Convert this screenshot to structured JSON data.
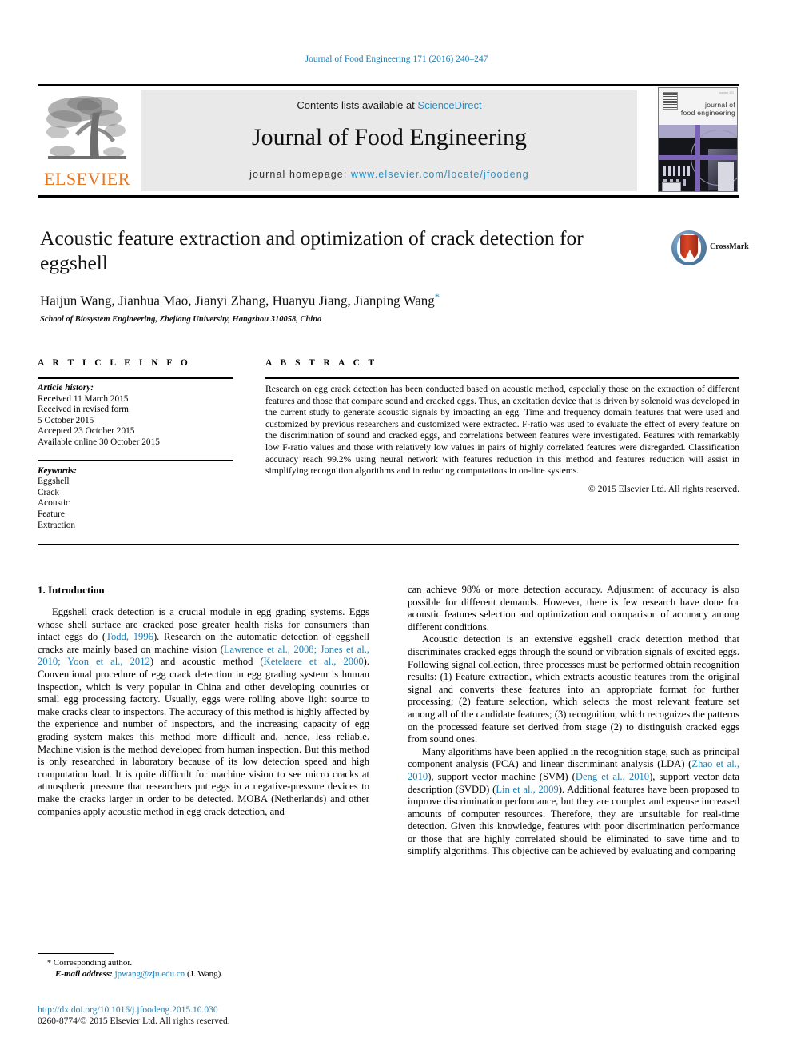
{
  "running_head": "Journal of Food Engineering 171 (2016) 240–247",
  "masthead": {
    "contents_prefix": "Contents lists available at ",
    "contents_link": "ScienceDirect",
    "journal_name": "Journal of Food Engineering",
    "homepage_prefix": "journal homepage: ",
    "homepage_url": "www.elsevier.com/locate/jfoodeng",
    "publisher": "ELSEVIER",
    "cover_title_line1": "journal of",
    "cover_title_line2": "food engineering",
    "cover_tiny": "volume 171"
  },
  "article": {
    "title": "Acoustic feature extraction and optimization of crack detection for eggshell",
    "authors": "Haijun Wang, Jianhua Mao, Jianyi Zhang, Huanyu Jiang, Jianping Wang",
    "corresponding_marker": "*",
    "affiliation": "School of Biosystem Engineering, Zhejiang University, Hangzhou 310058, China",
    "crossmark_label": "CrossMark"
  },
  "info": {
    "heading": "A R T I C L E   I N F O",
    "history_title": "Article history:",
    "history": [
      "Received 11 March 2015",
      "Received in revised form",
      "5 October 2015",
      "Accepted 23 October 2015",
      "Available online 30 October 2015"
    ],
    "keywords_title": "Keywords:",
    "keywords": [
      "Eggshell",
      "Crack",
      "Acoustic",
      "Feature",
      "Extraction"
    ]
  },
  "abstract": {
    "heading": "A B S T R A C T",
    "text": "Research on egg crack detection has been conducted based on acoustic method, especially those on the extraction of different features and those that compare sound and cracked eggs. Thus, an excitation device that is driven by solenoid was developed in the current study to generate acoustic signals by impacting an egg. Time and frequency domain features that were used and customized by previous researchers and customized were extracted. F-ratio was used to evaluate the effect of every feature on the discrimination of sound and cracked eggs, and correlations between features were investigated. Features with remarkably low F-ratio values and those with relatively low values in pairs of highly correlated features were disregarded. Classification accuracy reach 99.2% using neural network with features reduction in this method and features reduction will assist in simplifying recognition algorithms and in reducing computations in on-line systems.",
    "copyright": "© 2015 Elsevier Ltd. All rights reserved."
  },
  "body": {
    "section_heading": "1.  Introduction",
    "left_para1_a": "Eggshell crack detection is a crucial module in egg grading systems. Eggs whose shell surface are cracked pose greater health risks for consumers than intact eggs do (",
    "left_cit1": "Todd, 1996",
    "left_para1_b": "). Research on the automatic detection of eggshell cracks are mainly based on machine vision (",
    "left_cit2": "Lawrence et al., 2008; Jones et al., 2010; Yoon et al., 2012",
    "left_para1_c": ") and acoustic method (",
    "left_cit3": "Ketelaere et al., 2000",
    "left_para1_d": "). Conventional procedure of egg crack detection in egg grading system is human inspection, which is very popular in China and other developing countries or small egg processing factory. Usually, eggs were rolling above light source to make cracks clear to inspectors. The accuracy of this method is highly affected by the experience and number of inspectors, and the increasing capacity of egg grading system makes this method more difficult and, hence, less reliable. Machine vision is the method developed from human inspection. But this method is only researched in laboratory because of its low detection speed and high computation load. It is quite difficult for machine vision to see micro cracks at atmospheric pressure that researchers put eggs in a negative-pressure devices to make the cracks larger in order to be detected. MOBA (Netherlands) and other companies apply acoustic method in egg crack detection, and",
    "right_para1": "can achieve 98% or more detection accuracy. Adjustment of accuracy is also possible for different demands. However, there is few research have done for acoustic features selection and optimization and comparison of accuracy among different conditions.",
    "right_para2": "Acoustic detection is an extensive eggshell crack detection method that discriminates cracked eggs through the sound or vibration signals of excited eggs. Following signal collection, three processes must be performed obtain recognition results: (1) Feature extraction, which extracts acoustic features from the original signal and converts these features into an appropriate format for further processing; (2) feature selection, which selects the most relevant feature set among all of the candidate features; (3) recognition, which recognizes the patterns on the processed feature set derived from stage (2) to distinguish cracked eggs from sound ones.",
    "right_para3_a": "Many algorithms have been applied in the recognition stage, such as principal component analysis (PCA) and linear discriminant analysis (LDA) (",
    "right_cit1": "Zhao et al., 2010",
    "right_para3_b": "), support vector machine (SVM) (",
    "right_cit2": "Deng et al., 2010",
    "right_para3_c": "), support vector data description (SVDD) (",
    "right_cit3": "Lin et al., 2009",
    "right_para3_d": "). Additional features have been proposed to improve discrimination performance, but they are complex and expense increased amounts of computer resources. Therefore, they are unsuitable for real-time detection. Given this knowledge, features with poor discrimination performance or those that are highly correlated should be eliminated to save time and to simplify algorithms. This objective can be achieved by evaluating and comparing"
  },
  "footnote": {
    "star": "*",
    "corresponding": " Corresponding author.",
    "email_label": "E-mail address:",
    "email": "jpwang@zju.edu.cn",
    "email_suffix": " (J. Wang)."
  },
  "doi": {
    "url": "http://dx.doi.org/10.1016/j.jfoodeng.2015.10.030",
    "issn_line": "0260-8774/© 2015 Elsevier Ltd. All rights reserved."
  },
  "colors": {
    "link_blue": "#1a7db5",
    "elsevier_orange": "#E87722",
    "masthead_gray": "#e9e9e9"
  }
}
